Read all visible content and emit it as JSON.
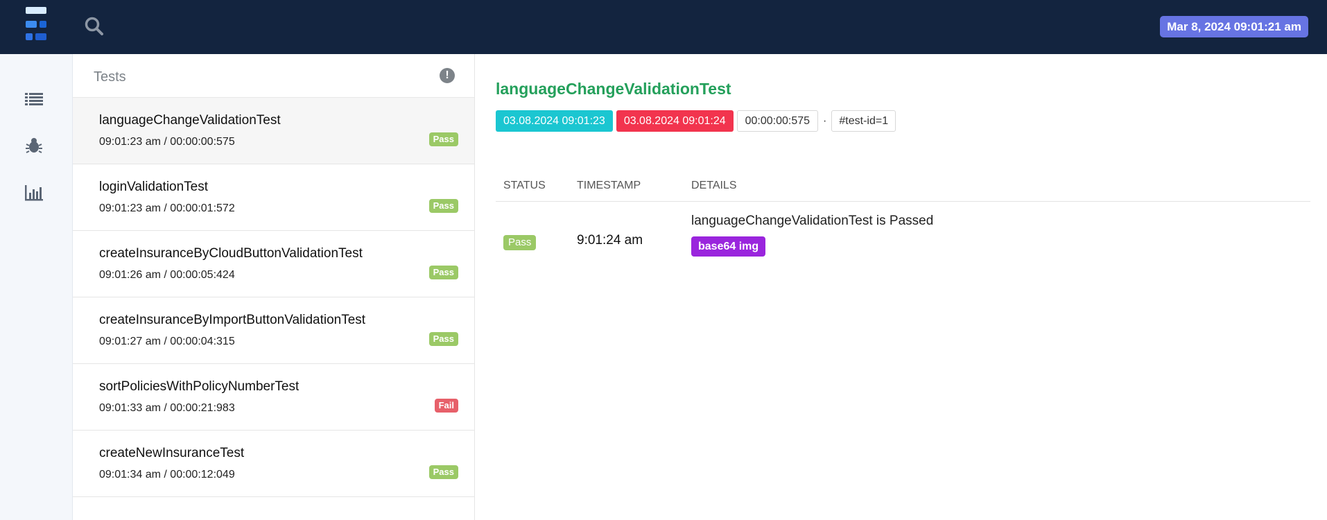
{
  "header": {
    "logo_name": "extent-logo",
    "search_icon": "search-icon",
    "report_date": "Mar 8, 2024 09:01:21 am"
  },
  "sidenav": {
    "items": [
      {
        "icon": "list-icon"
      },
      {
        "icon": "bug-icon"
      },
      {
        "icon": "bar-chart-icon"
      }
    ]
  },
  "test_list": {
    "title": "Tests",
    "info_icon": "!",
    "items": [
      {
        "name": "languageChangeValidationTest",
        "meta": "09:01:23 am / 00:00:00:575",
        "status": "Pass"
      },
      {
        "name": "loginValidationTest",
        "meta": "09:01:23 am / 00:00:01:572",
        "status": "Pass"
      },
      {
        "name": "createInsuranceByCloudButtonValidationTest",
        "meta": "09:01:26 am / 00:00:05:424",
        "status": "Pass"
      },
      {
        "name": "createInsuranceByImportButtonValidationTest",
        "meta": "09:01:27 am / 00:00:04:315",
        "status": "Pass"
      },
      {
        "name": "sortPoliciesWithPolicyNumberTest",
        "meta": "09:01:33 am / 00:00:21:983",
        "status": "Fail"
      },
      {
        "name": "createNewInsuranceTest",
        "meta": "09:01:34 am / 00:00:12:049",
        "status": "Pass"
      }
    ]
  },
  "detail": {
    "title": "languageChangeValidationTest",
    "start_time": "03.08.2024 09:01:23",
    "end_time": "03.08.2024 09:01:24",
    "duration": "00:00:00:575",
    "separator": "·",
    "test_id": "#test-id=1",
    "columns": {
      "status": "STATUS",
      "timestamp": "TIMESTAMP",
      "details": "DETAILS"
    },
    "log": {
      "status": "Pass",
      "timestamp": "9:01:24 am",
      "message": "languageChangeValidationTest is Passed",
      "attachment_label": "base64 img"
    }
  },
  "colors": {
    "topbar": "#13243f",
    "pass": "#9bc966",
    "fail": "#e7606a",
    "title_green": "#24a05b",
    "start_badge": "#1bc6d1",
    "end_badge": "#f2344e",
    "date_badge": "#6774e3",
    "img_button": "#9a25dd"
  }
}
